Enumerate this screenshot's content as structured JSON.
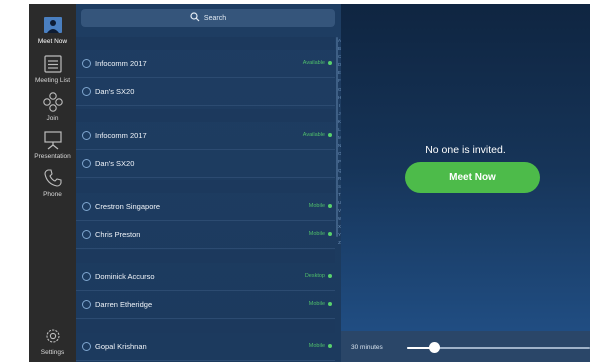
{
  "nav": {
    "items": [
      {
        "label": "Meet Now",
        "icon": "meet-now-icon"
      },
      {
        "label": "Meeting List",
        "icon": "meeting-list-icon"
      },
      {
        "label": "Join",
        "icon": "join-icon"
      },
      {
        "label": "Presentation",
        "icon": "presentation-icon"
      },
      {
        "label": "Phone",
        "icon": "phone-icon"
      }
    ],
    "settings_label": "Settings"
  },
  "search": {
    "label": "Search"
  },
  "contacts": {
    "sections": [
      {
        "header": "",
        "rows": [
          {
            "name": "Infocomm 2017",
            "status": "Available"
          },
          {
            "name": "Dan's SX20",
            "status": ""
          }
        ]
      },
      {
        "header": "",
        "rows": [
          {
            "name": "Infocomm 2017",
            "status": "Available"
          },
          {
            "name": "Dan's SX20",
            "status": ""
          }
        ]
      },
      {
        "header": "",
        "rows": [
          {
            "name": "Crestron Singapore",
            "status": "Mobile"
          },
          {
            "name": "Chris Preston",
            "status": "Mobile"
          }
        ]
      },
      {
        "header": "",
        "rows": [
          {
            "name": "Dominick Accurso",
            "status": "Desktop"
          },
          {
            "name": "Darren Etheridge",
            "status": "Mobile"
          }
        ]
      },
      {
        "header": "",
        "rows": [
          {
            "name": "Gopal Krishnan",
            "status": "Mobile"
          }
        ]
      }
    ],
    "alphabet": [
      "A",
      "B",
      "C",
      "D",
      "E",
      "F",
      "G",
      "H",
      "I",
      "J",
      "K",
      "L",
      "M",
      "N",
      "O",
      "P",
      "Q",
      "R",
      "S",
      "T",
      "U",
      "V",
      "W",
      "X",
      "Y",
      "Z"
    ]
  },
  "main": {
    "empty_message": "No one is invited.",
    "meet_now_button": "Meet Now",
    "duration_label": "30 minutes",
    "duration_fraction": 0.15
  },
  "colors": {
    "accent_green": "#4dbb4a",
    "available_dot": "#59d16c",
    "nav_bg": "#2b2b2b"
  }
}
